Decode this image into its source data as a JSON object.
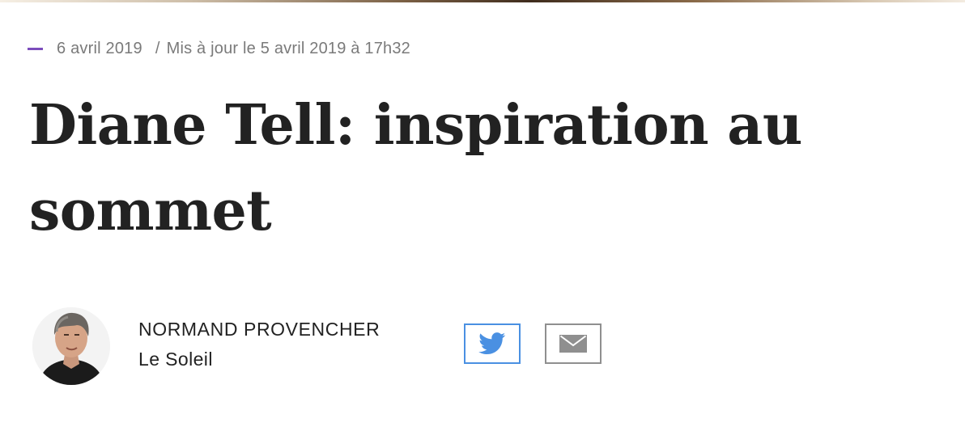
{
  "article": {
    "date": "6 avril 2019",
    "separator": "/",
    "updated": "Mis à jour le 5 avril 2019 à 17h32",
    "title": "Diane Tell: inspiration au sommet"
  },
  "author": {
    "name": "NORMAND PROVENCHER",
    "outlet": "Le Soleil",
    "avatar_icon": "author-portrait"
  },
  "share": {
    "twitter_icon": "twitter-bird-icon",
    "email_icon": "envelope-icon"
  },
  "colors": {
    "accent_dash": "#7c4dbc",
    "twitter_border": "#4a90e2",
    "twitter_icon": "#4a90e2",
    "email_border": "#8f8f8f",
    "email_icon": "#8f8f8f",
    "meta_text": "#7a7a7a",
    "title_text": "#222222"
  }
}
